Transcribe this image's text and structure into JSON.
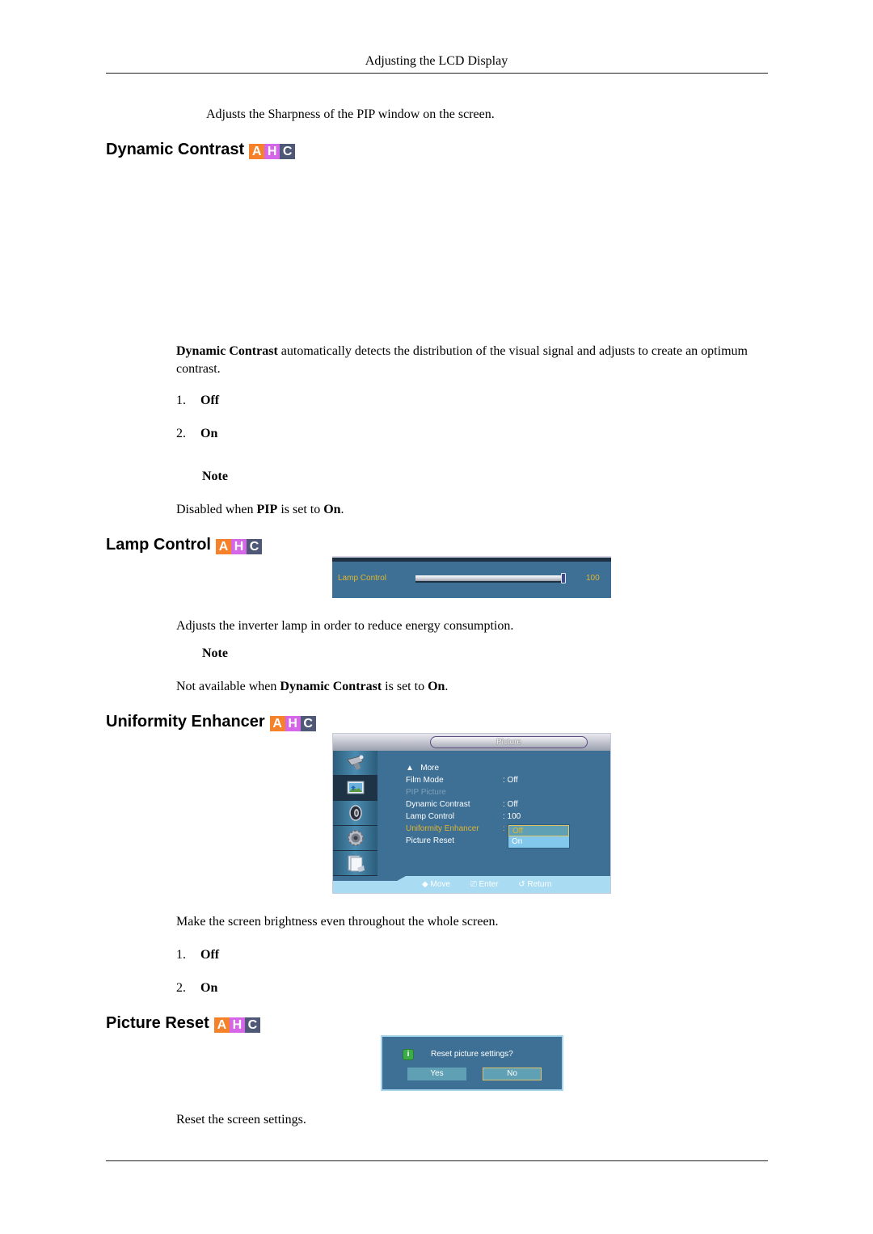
{
  "header": {
    "title": "Adjusting the LCD Display"
  },
  "intro_text": "Adjusts the Sharpness of the PIP window on the screen.",
  "badge": {
    "a": "A",
    "h": "H",
    "c": "C",
    "colors": {
      "a": "#f5822a",
      "h": "#d666e8",
      "c": "#4f5877"
    }
  },
  "dynamic_contrast": {
    "title": "Dynamic Contrast",
    "desc_bold": "Dynamic Contrast",
    "desc_rest": " automatically detects the distribution of the visual signal and adjusts to create an optimum contrast.",
    "options": [
      {
        "num": "1.",
        "label": "Off"
      },
      {
        "num": "2.",
        "label": "On"
      }
    ],
    "note_label": "Note",
    "note": {
      "prefix": "Disabled when ",
      "bold1": "PIP",
      "mid": " is set to ",
      "bold2": "On",
      "suffix": "."
    }
  },
  "lamp_control": {
    "title": "Lamp Control",
    "osd": {
      "label": "Lamp Control",
      "value": "100",
      "level_percent": 100
    },
    "desc": "Adjusts the inverter lamp in order to reduce energy consumption.",
    "note_label": "Note",
    "note": {
      "prefix": "Not available when ",
      "bold1": "Dynamic Contrast",
      "mid": " is set to ",
      "bold2": "On",
      "suffix": "."
    }
  },
  "uniformity_enhancer": {
    "title": "Uniformity Enhancer",
    "osd": {
      "title": "Picture",
      "sidebar_icons": [
        "input-icon",
        "picture-icon",
        "sound-icon",
        "setup-icon",
        "multi-control-icon"
      ],
      "more_label": "More",
      "items": [
        {
          "label": "Film Mode",
          "value": ": Off",
          "state": "normal"
        },
        {
          "label": "PIP Picture",
          "value": "",
          "state": "disabled"
        },
        {
          "label": "Dynamic Contrast",
          "value": ": Off",
          "state": "normal"
        },
        {
          "label": "Lamp Control",
          "value": ": 100",
          "state": "normal"
        },
        {
          "label": "Uniformity Enhancer",
          "value": ":",
          "state": "highlight"
        },
        {
          "label": "Picture Reset",
          "value": "",
          "state": "normal"
        }
      ],
      "dropdown": {
        "selected": "Off",
        "other": "On"
      },
      "hints": {
        "move": "Move",
        "enter": "Enter",
        "return": "Return"
      }
    },
    "desc": "Make the screen brightness even throughout the whole screen.",
    "options": [
      {
        "num": "1.",
        "label": "Off"
      },
      {
        "num": "2.",
        "label": "On"
      }
    ]
  },
  "picture_reset": {
    "title": "Picture Reset",
    "osd": {
      "info_glyph": "i",
      "message": "Reset picture settings?",
      "yes": "Yes",
      "no": "No"
    },
    "desc": "Reset the screen settings."
  }
}
